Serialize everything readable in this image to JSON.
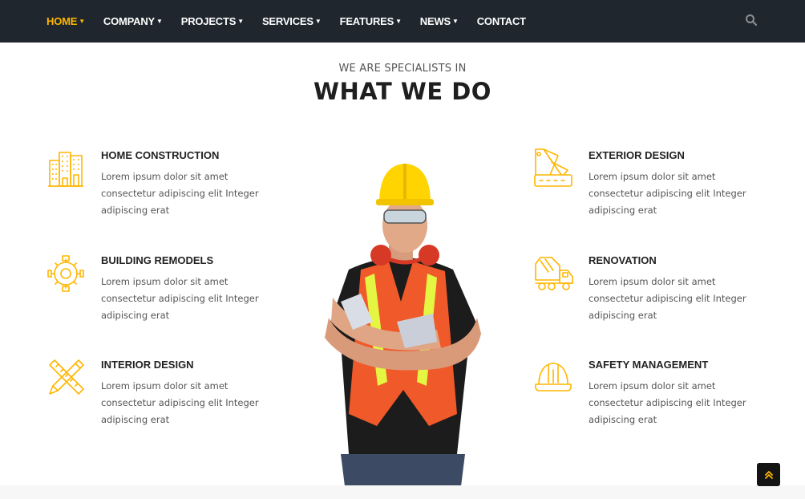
{
  "nav": {
    "items": [
      {
        "label": "HOME",
        "has_dropdown": true,
        "active": true
      },
      {
        "label": "COMPANY",
        "has_dropdown": true,
        "active": false
      },
      {
        "label": "PROJECTS",
        "has_dropdown": true,
        "active": false
      },
      {
        "label": "SERVICES",
        "has_dropdown": true,
        "active": false
      },
      {
        "label": "FEATURES",
        "has_dropdown": true,
        "active": false
      },
      {
        "label": "NEWS",
        "has_dropdown": true,
        "active": false
      },
      {
        "label": "CONTACT",
        "has_dropdown": false,
        "active": false
      }
    ],
    "search_icon": "search-icon",
    "colors": {
      "background": "#1f262d",
      "active": "#ffb600",
      "text": "#ffffff"
    }
  },
  "section": {
    "eyebrow": "WE ARE SPECIALISTS IN",
    "title": "WHAT WE DO"
  },
  "services": {
    "left": [
      {
        "title": "HOME CONSTRUCTION",
        "text": "Lorem ipsum dolor sit amet consectetur adipiscing elit Integer adipiscing erat",
        "icon": "buildings-icon"
      },
      {
        "title": "BUILDING REMODELS",
        "text": "Lorem ipsum dolor sit amet consectetur adipiscing elit Integer adipiscing erat",
        "icon": "gear-wrench-icon"
      },
      {
        "title": "INTERIOR DESIGN",
        "text": "Lorem ipsum dolor sit amet consectetur adipiscing elit Integer adipiscing erat",
        "icon": "pencil-ruler-icon"
      }
    ],
    "right": [
      {
        "title": "EXTERIOR DESIGN",
        "text": "Lorem ipsum dolor sit amet consectetur adipiscing elit Integer adipiscing erat",
        "icon": "color-swatch-icon"
      },
      {
        "title": "RENOVATION",
        "text": "Lorem ipsum dolor sit amet consectetur adipiscing elit Integer adipiscing erat",
        "icon": "cement-truck-icon"
      },
      {
        "title": "SAFETY MANAGEMENT",
        "text": "Lorem ipsum dolor sit amet consectetur adipiscing elit Integer adipiscing erat",
        "icon": "hard-hat-icon"
      }
    ],
    "icon_color": "#ffb600"
  },
  "back_to_top_icon": "double-chevron-up-icon"
}
